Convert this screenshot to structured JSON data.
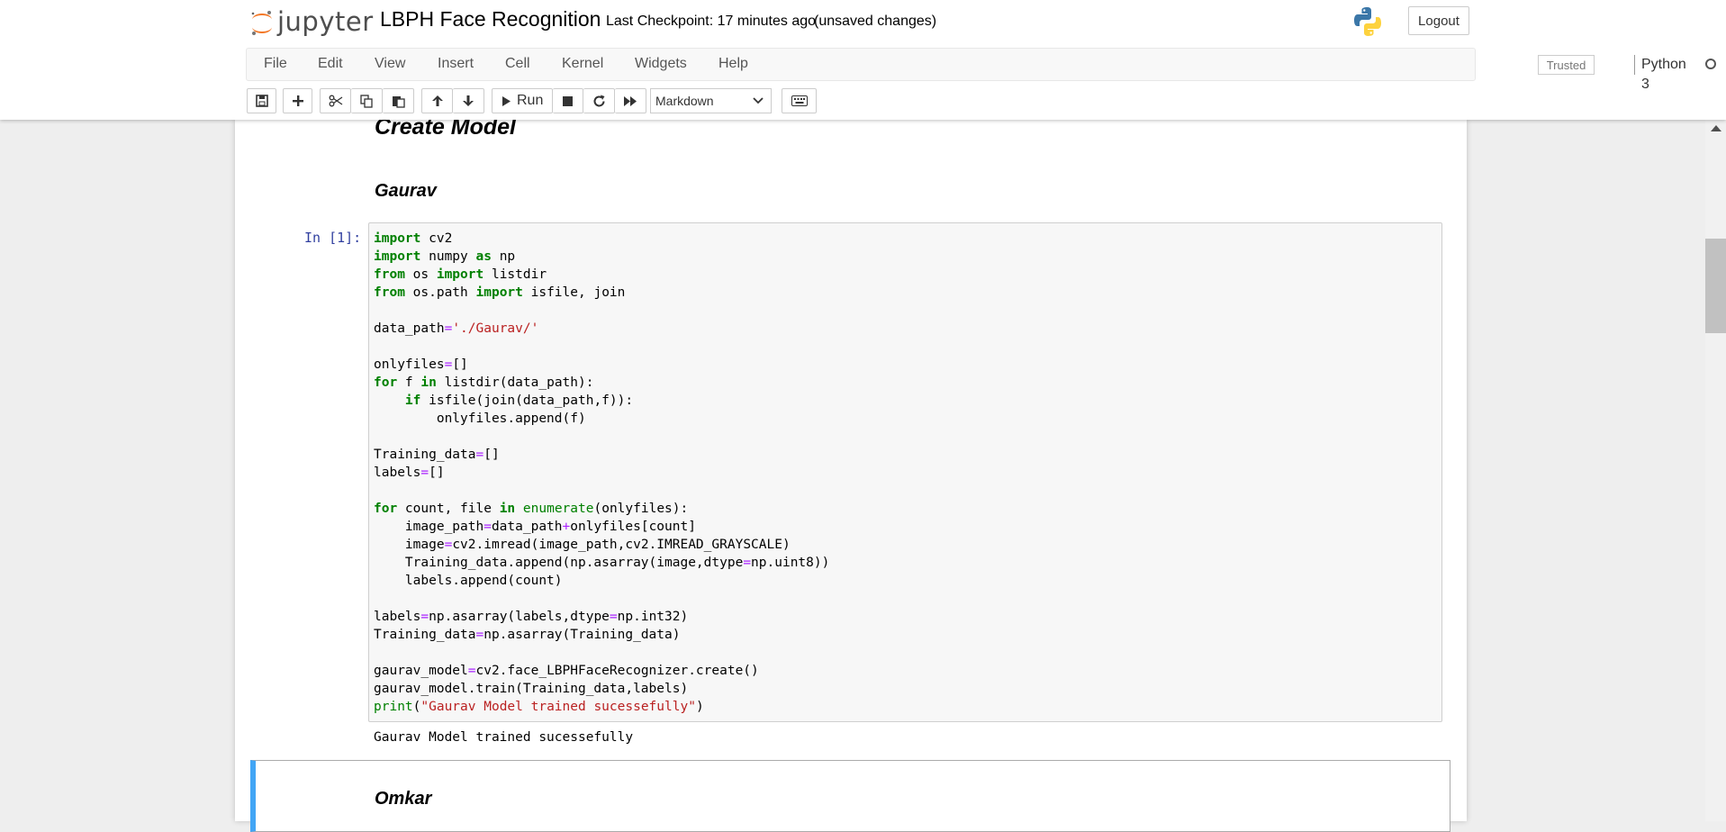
{
  "header": {
    "logo_text": "jupyter",
    "notebook_title": "LBPH Face Recognition",
    "checkpoint": "Last Checkpoint: 17 minutes ago",
    "unsaved": "(unsaved changes)",
    "logout_label": "Logout"
  },
  "menu": {
    "items": [
      "File",
      "Edit",
      "View",
      "Insert",
      "Cell",
      "Kernel",
      "Widgets",
      "Help"
    ],
    "trusted_label": "Trusted",
    "kernel_name": "Python 3"
  },
  "toolbar": {
    "run_label": "Run",
    "cell_type": "Markdown"
  },
  "notebook": {
    "heading_create": "Create Model",
    "heading_gaurav": "Gaurav",
    "heading_omkar": "Omkar",
    "cell1_prompt": "In [1]:",
    "cell1_output": "Gaurav Model trained sucessefully"
  },
  "colors": {
    "accent": "#42a5f5",
    "prompt": "#303f9f",
    "keyword": "#008000",
    "string": "#ba2121",
    "operator": "#aa22ff"
  }
}
